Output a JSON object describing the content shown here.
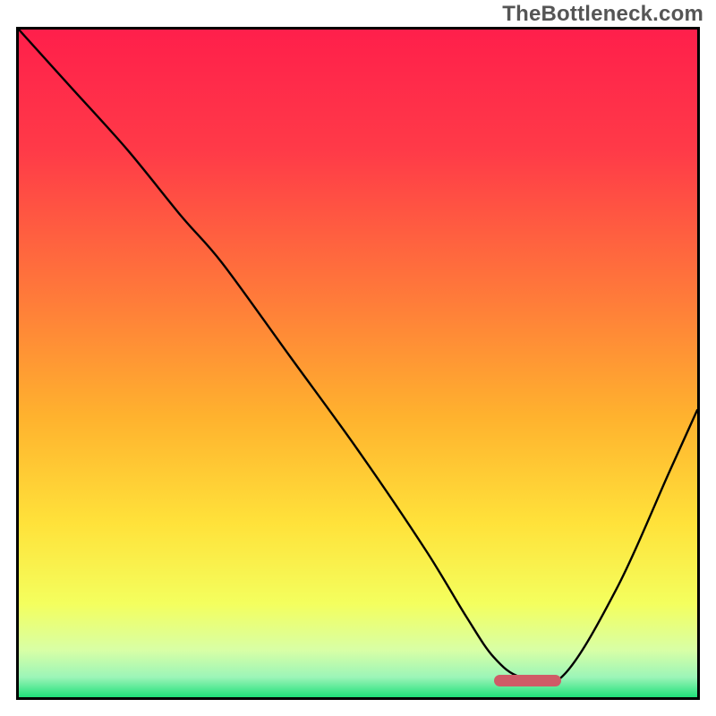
{
  "watermark": "TheBottleneck.com",
  "chart_data": {
    "type": "line",
    "title": "",
    "xlabel": "",
    "ylabel": "",
    "xlim": [
      0,
      100
    ],
    "ylim": [
      0,
      100
    ],
    "grid": false,
    "series": [
      {
        "name": "bottleneck-curve",
        "x": [
          0,
          8,
          16,
          24,
          30,
          40,
          50,
          60,
          66,
          70,
          74,
          80,
          88,
          96,
          100
        ],
        "y": [
          100,
          91,
          82,
          72,
          65,
          51,
          37,
          22,
          12,
          6,
          3,
          3,
          16,
          34,
          43
        ]
      }
    ],
    "gradient_stops": [
      {
        "offset": 0.0,
        "color": "#ff1f4b"
      },
      {
        "offset": 0.18,
        "color": "#ff3a48"
      },
      {
        "offset": 0.4,
        "color": "#ff7a3a"
      },
      {
        "offset": 0.58,
        "color": "#ffb22e"
      },
      {
        "offset": 0.74,
        "color": "#ffe23a"
      },
      {
        "offset": 0.86,
        "color": "#f4ff5e"
      },
      {
        "offset": 0.93,
        "color": "#d8ffa6"
      },
      {
        "offset": 0.97,
        "color": "#9cf5b8"
      },
      {
        "offset": 1.0,
        "color": "#20e07a"
      }
    ],
    "optimal_marker": {
      "x_start": 70,
      "x_end": 80,
      "y": 2.5,
      "color": "#cf5b67"
    }
  }
}
